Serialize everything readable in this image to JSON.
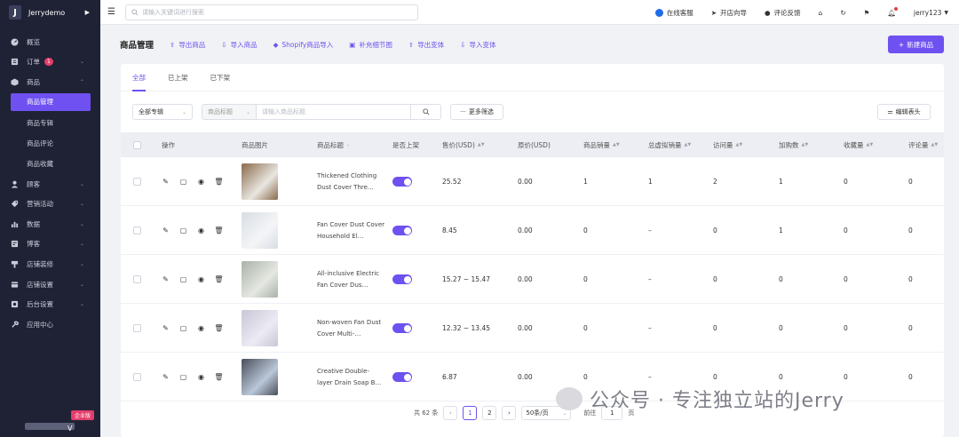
{
  "brand": {
    "logo": "J",
    "name": "Jerrydemo"
  },
  "sidebar": {
    "items": [
      {
        "label": "概览",
        "icon": "dashboard-icon",
        "chevron": false
      },
      {
        "label": "订单",
        "icon": "orders-icon",
        "chevron": true,
        "badge": "1"
      },
      {
        "label": "商品",
        "icon": "products-icon",
        "chevron": true,
        "expanded": true
      },
      {
        "label": "顾客",
        "icon": "customer-icon",
        "chevron": true
      },
      {
        "label": "营销活动",
        "icon": "marketing-icon",
        "chevron": true
      },
      {
        "label": "数据",
        "icon": "data-icon",
        "chevron": true
      },
      {
        "label": "博客",
        "icon": "blog-icon",
        "chevron": true
      },
      {
        "label": "店铺装修",
        "icon": "decorate-icon",
        "chevron": true
      },
      {
        "label": "店铺设置",
        "icon": "store-settings-icon",
        "chevron": true
      },
      {
        "label": "后台设置",
        "icon": "admin-settings-icon",
        "chevron": true
      },
      {
        "label": "应用中心",
        "icon": "app-center-icon",
        "chevron": false
      }
    ],
    "sub_items": [
      "商品管理",
      "商品专辑",
      "商品评论",
      "商品收藏"
    ],
    "enterprise_badge": "企业版",
    "footer_v": "V"
  },
  "topbar": {
    "search_placeholder": "请输入关键词进行搜索",
    "online_service": "在线客服",
    "store_guide": "开店向导",
    "feedback": "评论反馈",
    "username": "jerry123"
  },
  "page": {
    "title": "商品管理",
    "actions": [
      "导出商品",
      "导入商品",
      "Shopify商品导入",
      "补充细节图",
      "导出变体",
      "导入变体"
    ],
    "new_button": "新建商品"
  },
  "tabs": [
    "全部",
    "已上架",
    "已下架"
  ],
  "filters": {
    "collection": "全部专辑",
    "field": "商品标题",
    "placeholder": "请输入商品标题",
    "more": "更多筛选",
    "edit_header": "编辑表头"
  },
  "table": {
    "columns": {
      "ops": "操作",
      "image": "商品图片",
      "title": "商品标题",
      "listed": "是否上架",
      "price": "售价(USD)",
      "orig": "原价(USD)",
      "sales": "商品销量",
      "virtual": "总虚拟销量",
      "visits": "访问量",
      "cart": "加购数",
      "fav": "收藏量",
      "reviews": "评论量"
    },
    "rows": [
      {
        "title": "Thickened Clothing Dust Cover Thre…",
        "price": "25.52",
        "orig": "0.00",
        "sales": "1",
        "virtual": "1",
        "visits": "2",
        "cart": "1",
        "fav": "0",
        "reviews": "0"
      },
      {
        "title": "Fan Cover Dust Cover Household El…",
        "price": "8.45",
        "orig": "0.00",
        "sales": "0",
        "virtual": "–",
        "visits": "0",
        "cart": "1",
        "fav": "0",
        "reviews": "0"
      },
      {
        "title": "All-inclusive Electric Fan Cover Dus…",
        "price": "15.27 ~ 15.47",
        "orig": "0.00",
        "sales": "0",
        "virtual": "–",
        "visits": "0",
        "cart": "0",
        "fav": "0",
        "reviews": "0"
      },
      {
        "title": "Non-woven Fan Dust Cover Multi-…",
        "price": "12.32 ~ 13.45",
        "orig": "0.00",
        "sales": "0",
        "virtual": "–",
        "visits": "0",
        "cart": "0",
        "fav": "0",
        "reviews": "0"
      },
      {
        "title": "Creative Double-layer Drain Soap B…",
        "price": "6.87",
        "orig": "0.00",
        "sales": "0",
        "virtual": "–",
        "visits": "0",
        "cart": "0",
        "fav": "0",
        "reviews": "0"
      }
    ]
  },
  "pagination": {
    "total": "共 62 条",
    "pages": [
      "1",
      "2"
    ],
    "per_page": "50条/页",
    "goto": "前往",
    "goto_value": "1",
    "page_unit": "页"
  },
  "watermark": "公众号 · 专注独立站的Jerry",
  "colors": {
    "accent": "#6e51f0",
    "sidebar": "#1f2235",
    "badge": "#e33e6b"
  }
}
